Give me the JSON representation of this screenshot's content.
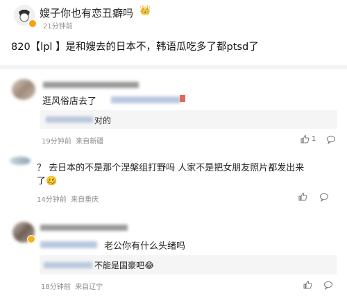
{
  "post": {
    "author": "嫂子你也有恋丑癖吗",
    "emoji": "👑",
    "time": "21分钟前",
    "text": "820【lpl 】是和嫂去的日本不，韩语瓜吃多了都ptsd了"
  },
  "comments": [
    {
      "text": "逛风俗店去了",
      "reply": {
        "text": "对的"
      },
      "meta": "19分钟前  来自新疆",
      "like_count": "1"
    },
    {
      "text": "？ 去日本的不是那个涅槃组打野吗 人家不是把女朋友照片都发出来了🥴",
      "meta": "14分钟前  来自重庆"
    },
    {
      "text": "老公你有什么头绪吗",
      "reply": {
        "text": "不能是国豪吧😂"
      },
      "meta": "18分钟前  来自辽宁"
    }
  ],
  "icons": {
    "like": "thumb-up-icon",
    "comment": "comment-bubble-icon"
  }
}
